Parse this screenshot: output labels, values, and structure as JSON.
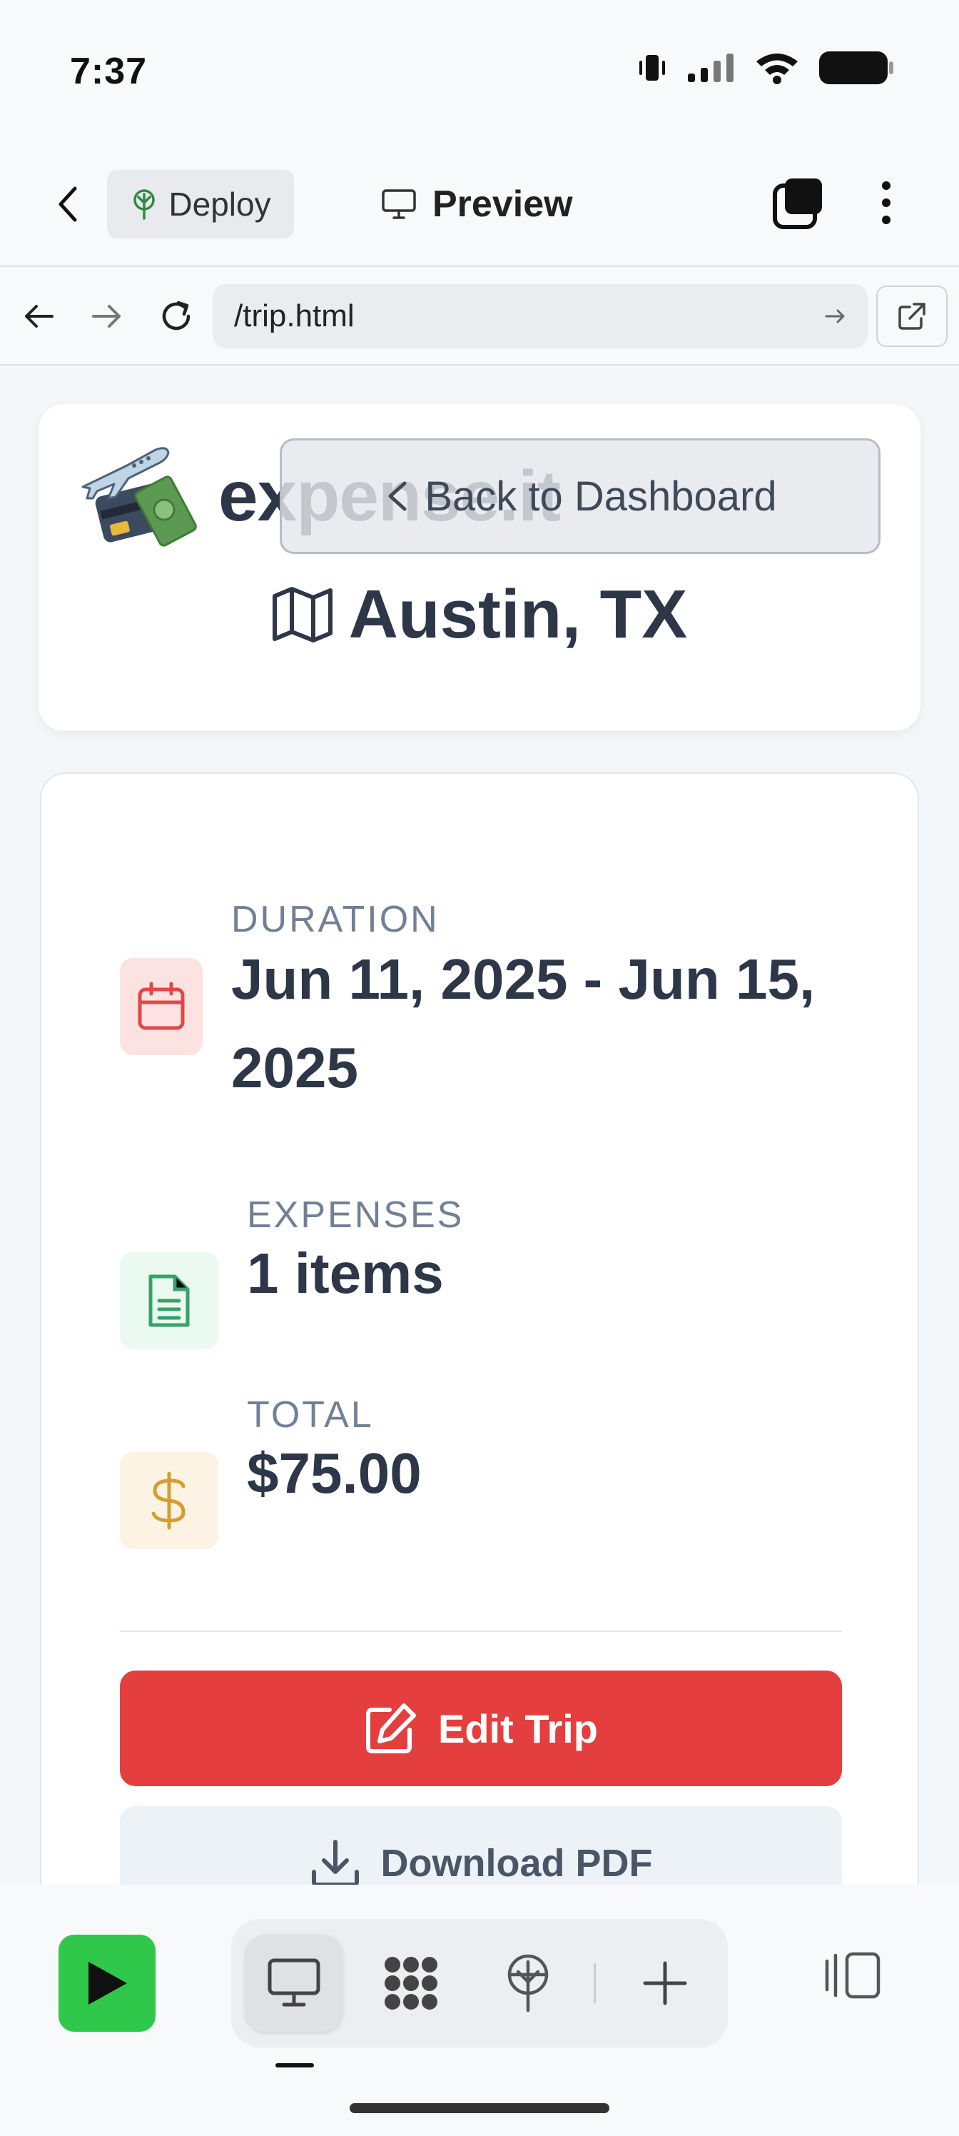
{
  "status_bar": {
    "time": "7:37"
  },
  "toolbar": {
    "deploy_label": "Deploy",
    "preview_label": "Preview"
  },
  "browser": {
    "url": "/trip.html"
  },
  "page": {
    "brand": "expense.it",
    "back_button_label": "Back to Dashboard",
    "trip_title": "Austin, TX",
    "duration_label": "DURATION",
    "duration_value_line1": "Jun 11, 2025 - Jun 15,",
    "duration_value_line2": "2025",
    "expenses_label": "EXPENSES",
    "expenses_value": "1 items",
    "total_label": "TOTAL",
    "total_value": "$75.00",
    "edit_button_label": "Edit Trip",
    "pdf_button_label": "Download PDF"
  },
  "colors": {
    "accent_red": "#e53e3e",
    "run_green": "#2fc84a",
    "icon_red_bg": "#fde2e2",
    "icon_green_bg": "#eafaf0",
    "icon_amber_bg": "#fdf3e4"
  },
  "icons": [
    "back-icon",
    "deploy-tree-icon",
    "monitor-icon",
    "tabs-icon",
    "more-icon",
    "arrow-left-icon",
    "arrow-right-icon",
    "reload-icon",
    "go-arrow-icon",
    "external-link-icon",
    "travel-logo-icon",
    "chevron-left-icon",
    "map-icon",
    "calendar-icon",
    "document-icon",
    "dollar-icon",
    "edit-icon",
    "download-icon",
    "play-icon",
    "grid-dots-icon",
    "deploy-icon",
    "plus-icon",
    "panel-icon"
  ]
}
